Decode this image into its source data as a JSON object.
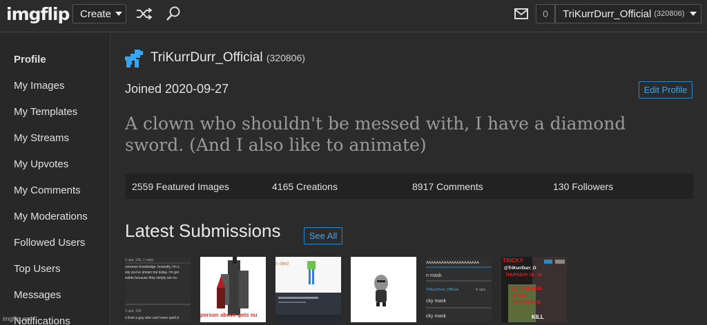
{
  "brand": {
    "logo": "imgflip"
  },
  "topbar": {
    "create_label": "Create",
    "shuffle_icon": "shuffle-icon",
    "search_icon": "search-icon",
    "mail_icon": "mail-icon",
    "notification_count": "0",
    "username": "TriKurrDurr_Official",
    "user_points": "(320806)"
  },
  "sidebar": {
    "items": [
      {
        "label": "Profile"
      },
      {
        "label": "My Images"
      },
      {
        "label": "My Templates"
      },
      {
        "label": "My Streams"
      },
      {
        "label": "My Upvotes"
      },
      {
        "label": "My Comments"
      },
      {
        "label": "My Moderations"
      },
      {
        "label": "Followed Users"
      },
      {
        "label": "Top Users"
      },
      {
        "label": "Messages"
      },
      {
        "label": "Notifications"
      }
    ]
  },
  "profile": {
    "name": "TriKurrDurr_Official",
    "points": "(320806)",
    "joined": "Joined 2020-09-27",
    "edit_label": "Edit Profile",
    "bio": "A clown who shouldn't be messed with, I have a diamond sword. (And I also like to animate)",
    "stats": {
      "featured": "2559 Featured Images",
      "creations": "4165 Creations",
      "comments": "8917 Comments",
      "followers": "130 Followers"
    }
  },
  "submissions": {
    "title": "Latest Submissions",
    "see_all_label": "See All",
    "thumb_texts": {
      "t1_line1": "1 ups, 13h, 1 reply",
      "t1_line2": "common knowledge. honestly, I'm s",
      "t1_line3": "sity you've shown me today. I'm goi",
      "t1_line4": "ssible because they simply are no",
      "t1_line5": "1 ups, 13h",
      "t1_line6": "s from a guy who can't even spell d",
      "t2_caption": "person above gets nu",
      "t3_text": "n died",
      "t5_line1": "AAAAAAAAAAAAAAAAAAAAA",
      "t5_line2": "n mask",
      "t5_line3": "TriKurrDurr_Official",
      "t5_line4": "0 ups, ",
      "t5_line5": "cky mask",
      "t5_line6": "cky mask",
      "t6_line1": "TRICKY",
      "t6_line2": "@TriKurrDurr_O",
      "t6_line3": "THURSDAY 10 - 31",
      "t6_line4": "GE CRAB BLEE",
      "t6_line5": "ST CHA",
      "t6_line6": "D CUSTOM IC",
      "t6_line7": "KILL"
    }
  },
  "watermark": "imgflip.com",
  "colors": {
    "accent": "#2a88c8",
    "avatar": "#34a7f0",
    "background": "#2b2b2c"
  }
}
